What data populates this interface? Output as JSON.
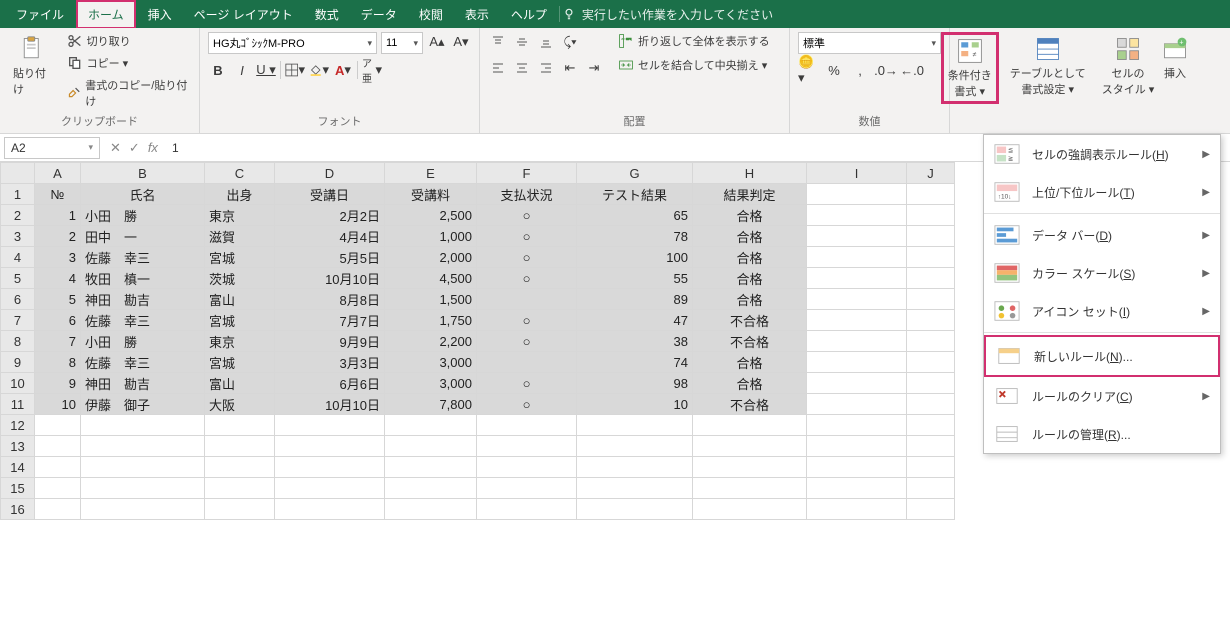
{
  "tabs": {
    "file": "ファイル",
    "home": "ホーム",
    "insert": "挿入",
    "pagelayout": "ページ レイアウト",
    "formulas": "数式",
    "data": "データ",
    "review": "校閲",
    "view": "表示",
    "help": "ヘルプ",
    "tellme": "実行したい作業を入力してください"
  },
  "ribbon": {
    "clipboard": {
      "label": "クリップボード",
      "paste": "貼り付け",
      "cut": "切り取り",
      "copy": "コピー ▾",
      "painter": "書式のコピー/貼り付け"
    },
    "font": {
      "label": "フォント",
      "name": "HG丸ｺﾞｼｯｸM-PRO",
      "size": "11"
    },
    "alignment": {
      "label": "配置",
      "wrap": "折り返して全体を表示する",
      "merge": "セルを結合して中央揃え ▾"
    },
    "number": {
      "label": "数値",
      "format": "標準"
    },
    "styles": {
      "cond": "条件付き\n書式 ▾",
      "table": "テーブルとして\n書式設定 ▾",
      "cell": "セルの\nスタイル ▾"
    },
    "cells": {
      "insert": "挿入"
    }
  },
  "formula_bar": {
    "name": "A2",
    "value": "1"
  },
  "cols": [
    "A",
    "B",
    "C",
    "D",
    "E",
    "F",
    "G",
    "H",
    "I",
    "J"
  ],
  "headers": {
    "no": "№",
    "name": "氏名",
    "origin": "出身",
    "date": "受講日",
    "fee": "受講料",
    "pay": "支払状況",
    "test": "テスト結果",
    "result": "結果判定"
  },
  "rows": [
    {
      "no": "1",
      "name": "小田　勝",
      "origin": "東京",
      "date": "2月2日",
      "fee": "2,500",
      "pay": "○",
      "test": "65",
      "result": "合格"
    },
    {
      "no": "2",
      "name": "田中　一",
      "origin": "滋賀",
      "date": "4月4日",
      "fee": "1,000",
      "pay": "○",
      "test": "78",
      "result": "合格"
    },
    {
      "no": "3",
      "name": "佐藤　幸三",
      "origin": "宮城",
      "date": "5月5日",
      "fee": "2,000",
      "pay": "○",
      "test": "100",
      "result": "合格"
    },
    {
      "no": "4",
      "name": "牧田　槙一",
      "origin": "茨城",
      "date": "10月10日",
      "fee": "4,500",
      "pay": "○",
      "test": "55",
      "result": "合格"
    },
    {
      "no": "5",
      "name": "神田　勘吉",
      "origin": "富山",
      "date": "8月8日",
      "fee": "1,500",
      "pay": "",
      "test": "89",
      "result": "合格"
    },
    {
      "no": "6",
      "name": "佐藤　幸三",
      "origin": "宮城",
      "date": "7月7日",
      "fee": "1,750",
      "pay": "○",
      "test": "47",
      "result": "不合格"
    },
    {
      "no": "7",
      "name": "小田　勝",
      "origin": "東京",
      "date": "9月9日",
      "fee": "2,200",
      "pay": "○",
      "test": "38",
      "result": "不合格"
    },
    {
      "no": "8",
      "name": "佐藤　幸三",
      "origin": "宮城",
      "date": "3月3日",
      "fee": "3,000",
      "pay": "",
      "test": "74",
      "result": "合格"
    },
    {
      "no": "9",
      "name": "神田　勘吉",
      "origin": "富山",
      "date": "6月6日",
      "fee": "3,000",
      "pay": "○",
      "test": "98",
      "result": "合格"
    },
    {
      "no": "10",
      "name": "伊藤　御子",
      "origin": "大阪",
      "date": "10月10日",
      "fee": "7,800",
      "pay": "○",
      "test": "10",
      "result": "不合格"
    }
  ],
  "empty_rows": [
    "12",
    "13",
    "14",
    "15",
    "16"
  ],
  "menu": {
    "highlight": "セルの強調表示ルール(H)",
    "toprank": "上位/下位ルール(T)",
    "databar": "データ バー(D)",
    "colorscale": "カラー スケール(S)",
    "iconset": "アイコン セット(I)",
    "newrule": "新しいルール(N)...",
    "clear": "ルールのクリア(C)",
    "manage": "ルールの管理(R)...",
    "h": "H",
    "t": "T",
    "d": "D",
    "s": "S",
    "i": "I",
    "n": "N",
    "c": "C",
    "r": "R"
  }
}
